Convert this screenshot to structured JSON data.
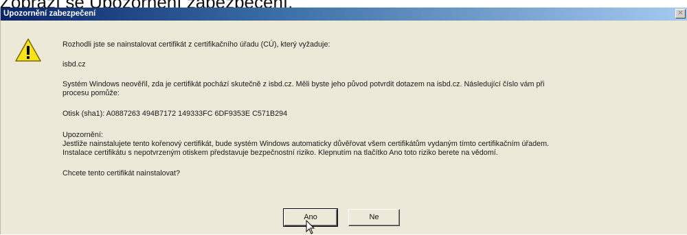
{
  "caption": "Zobrazí se Upozornění zabezpečení.",
  "dialog": {
    "title": "Upozornění zabezpečení",
    "paragraphs": {
      "intro": "Rozhodli jste se nainstalovat certifikát z certifikačního úřadu (CÚ), který vyžaduje:",
      "domain": "isbd.cz",
      "verify_1": "Systém Windows neověřil, zda je certifikát pochází skutečně z isbd.cz. Měli byste jeho původ potvrdit dotazem na isbd.cz. Následující číslo vám při",
      "verify_2": "procesu pomůže:",
      "thumbprint": "Otisk (sha1): A0887263 494B7172 149333FC 6DF9353E C571B294",
      "warning_heading": "Upozornění:",
      "warning_1": "Jestliže nainstalujete tento kořenový certifikát, bude systém Windows automaticky důvěřovat všem certifikátům vydaným tímto certifikačním úřadem.",
      "warning_2": "Instalace certifikátu s nepotvrzeným otiskem představuje bezpečnostní riziko. Klepnutím na tlačítko Ano toto riziko berete na vědomí.",
      "question": "Chcete tento certifikát nainstalovat?"
    },
    "buttons": {
      "yes": "Ano",
      "no": "Ne"
    }
  },
  "colors": {
    "titlebar_start": "#0a246a",
    "titlebar_end": "#a6caf0",
    "dialog_bg": "#ece9d8",
    "warning_yellow": "#f7e21b"
  },
  "icons": [
    "warning-icon",
    "close-icon",
    "mouse-cursor-icon"
  ]
}
